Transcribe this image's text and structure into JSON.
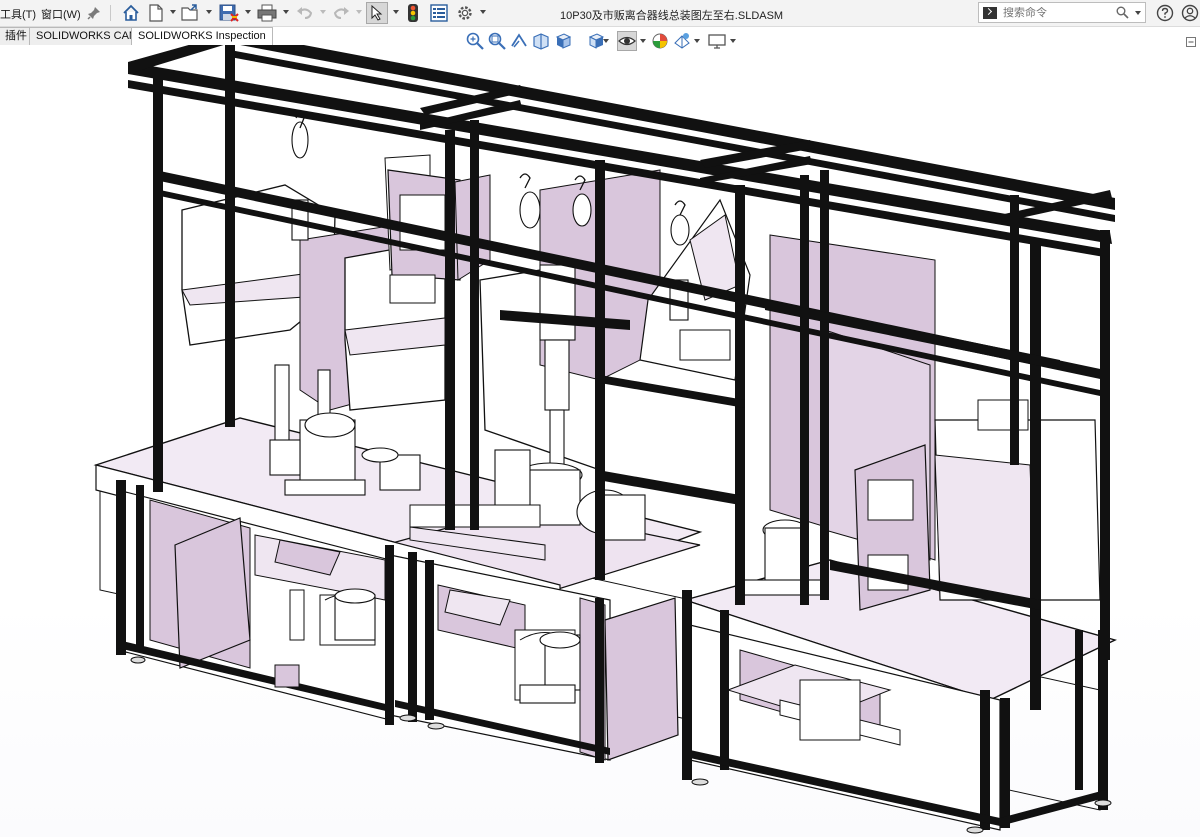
{
  "menu": {
    "tools": "工具(T)",
    "window": "窗口(W)"
  },
  "toolbar": {
    "icons": [
      "pin-icon",
      "home-icon",
      "new-document-icon",
      "open-icon",
      "save-icon",
      "print-icon",
      "undo-icon",
      "redo-icon",
      "select-pointer-icon",
      "traffic-light-icon",
      "file-properties-icon",
      "options-gear-icon"
    ]
  },
  "document": {
    "title": "10P30及市贩离合器线总装图左至右.SLDASM"
  },
  "search": {
    "placeholder": "搜索命令"
  },
  "tabs": [
    {
      "label": "插件"
    },
    {
      "label": "SOLIDWORKS CAM"
    },
    {
      "label": "SOLIDWORKS Inspection"
    }
  ],
  "headsup": {
    "icons": [
      "zoom-to-fit-icon",
      "zoom-area-icon",
      "previous-view-icon",
      "section-view-icon",
      "view-orientation-icon",
      "display-style-icon",
      "hide-show-items-icon",
      "edit-appearance-icon",
      "apply-scene-icon",
      "view-settings-icon"
    ]
  },
  "colors": {
    "frame": "#0d0d0d",
    "panel": "#d9c6dc",
    "panel_light": "#efe6f1",
    "surface": "#ffffff",
    "titlebar": "#f3f3f3"
  }
}
